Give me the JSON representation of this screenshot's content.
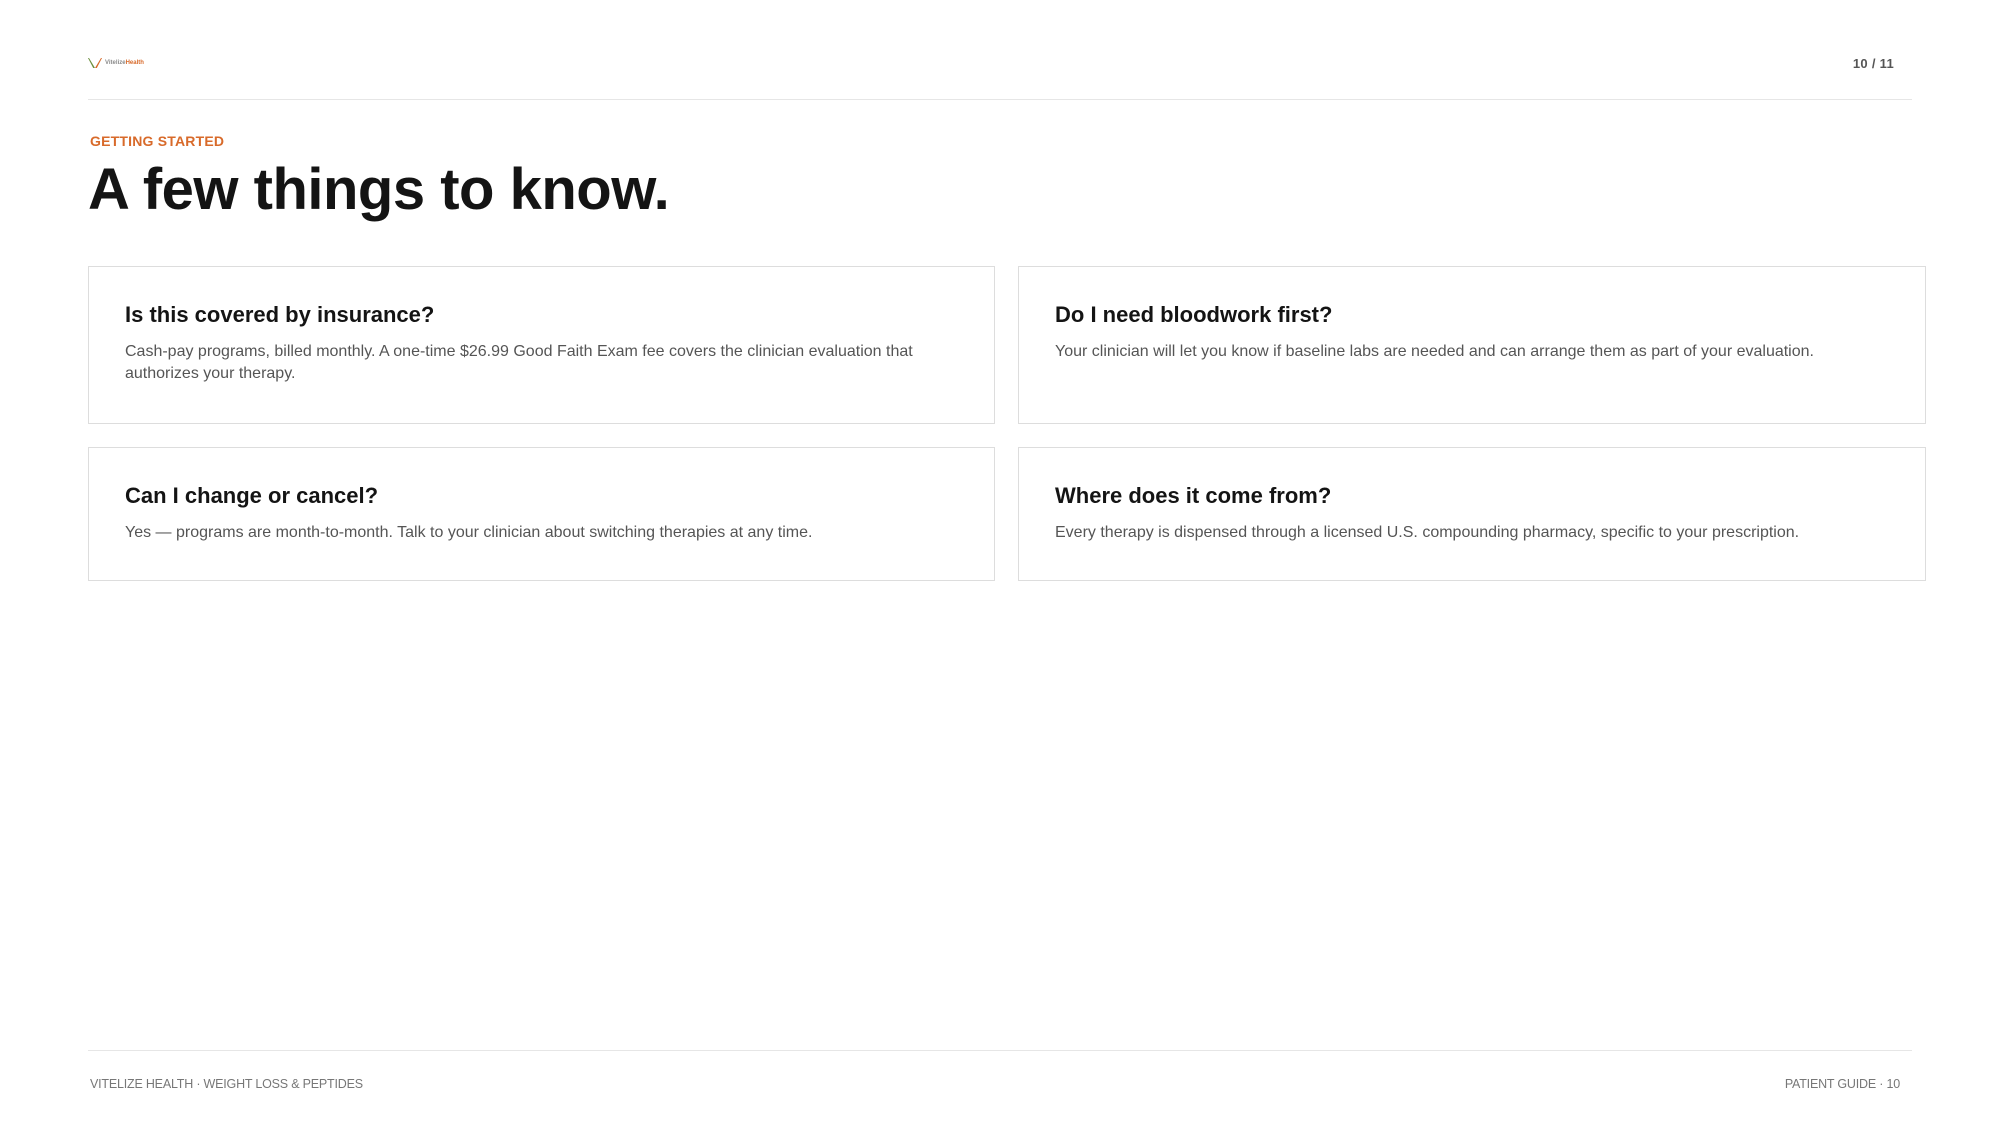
{
  "header": {
    "logo_text_primary": "Vitelize",
    "logo_text_accent": "Health",
    "page_count": "10 / 11"
  },
  "section": {
    "eyebrow": "GETTING STARTED",
    "title": "A few things to know."
  },
  "cards": [
    {
      "question": "Is this covered by insurance?",
      "answer": "Cash-pay programs, billed monthly. A one-time $26.99 Good Faith Exam fee covers the clinician evaluation that authorizes your therapy."
    },
    {
      "question": "Do I need bloodwork first?",
      "answer": "Your clinician will let you know if baseline labs are needed and can arrange them as part of your evaluation."
    },
    {
      "question": "Can I change or cancel?",
      "answer": "Yes — programs are month-to-month. Talk to your clinician about switching therapies at any time."
    },
    {
      "question": "Where does it come from?",
      "answer": "Every therapy is dispensed through a licensed U.S. compounding pharmacy, specific to your prescription."
    }
  ],
  "footer": {
    "left": "VITELIZE HEALTH · WEIGHT LOSS & PEPTIDES",
    "right": "PATIENT GUIDE · 10"
  },
  "colors": {
    "accent": "#d86a2a",
    "logo_green": "#6b8f3e",
    "text_dark": "#141414",
    "text_muted": "#555555",
    "border": "#dddddd"
  }
}
